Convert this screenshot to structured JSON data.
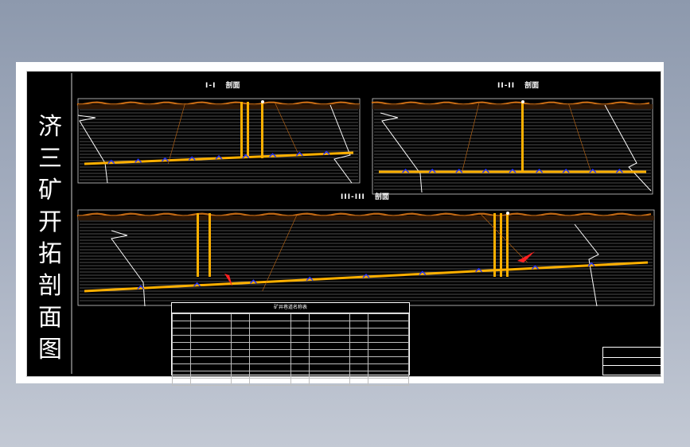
{
  "side_title": [
    "济",
    "三",
    "矿",
    "开",
    "拓",
    "剖",
    "面",
    "图"
  ],
  "sections": [
    {
      "id": "sec1",
      "num": "I-I",
      "name": "剖面"
    },
    {
      "id": "sec2",
      "num": "II-II",
      "name": "剖面"
    },
    {
      "id": "sec3",
      "num": "III-III",
      "name": "剖面"
    }
  ],
  "legend": {
    "title": "矿井巷道名称表",
    "rows": 10,
    "cols": 8
  },
  "colors": {
    "ground": "#c46a14",
    "shaft": "#ffb000",
    "roadway": "#ffb000",
    "water": "#2233ff",
    "strata": "#d8d8d8",
    "arrow": "#ff2020"
  }
}
